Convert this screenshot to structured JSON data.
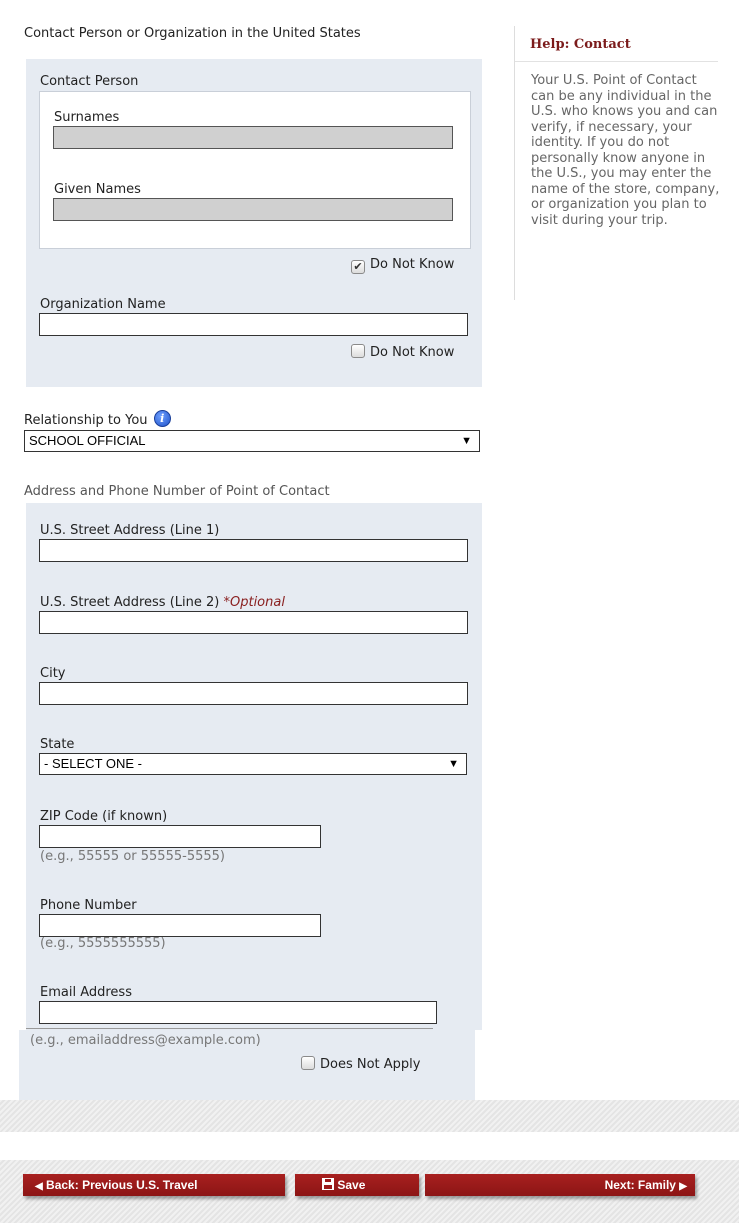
{
  "contact_section": {
    "title": "Contact Person or Organization in the United States",
    "contact_person": {
      "title": "Contact Person",
      "surnames_label": "Surnames",
      "surnames_value": "",
      "given_names_label": "Given Names",
      "given_names_value": "",
      "do_not_know_label": "Do Not Know",
      "do_not_know_checked": true
    },
    "organization": {
      "label": "Organization Name",
      "value": "",
      "do_not_know_label": "Do Not Know",
      "do_not_know_checked": false
    }
  },
  "relationship": {
    "label": "Relationship to You",
    "info_icon": "info-icon",
    "selected": "SCHOOL OFFICIAL"
  },
  "address_section": {
    "title": "Address and Phone Number of Point of Contact",
    "street1_label": "U.S. Street Address (Line 1)",
    "street2_label": "U.S. Street Address (Line 2)",
    "street2_optional": "*Optional",
    "city_label": "City",
    "state_label": "State",
    "state_selected": "- SELECT ONE -",
    "zip_label": "ZIP Code (if known)",
    "zip_hint": "(e.g., 55555 or 55555-5555)",
    "phone_label": "Phone Number",
    "phone_hint": "(e.g., 5555555555)",
    "email_label": "Email Address",
    "email_hint": "(e.g., emailaddress@example.com)",
    "does_not_apply_label": "Does Not Apply",
    "does_not_apply_checked": false
  },
  "help": {
    "title": "Help: Contact",
    "text": "Your U.S. Point of Contact can be any individual in the U.S. who knows you and can verify, if necessary, your identity. If you do not personally know anyone in the U.S., you may enter the name of the store, company, or organization you plan to visit during your trip."
  },
  "navigation": {
    "back_label": "Back: Previous U.S. Travel",
    "save_label": "Save",
    "next_label": "Next: Family"
  },
  "colors": {
    "panel_bg": "#e6ebf2",
    "nav_button": "#9b1b1b",
    "help_title": "#7b1b1b",
    "optional": "#8a2020"
  }
}
